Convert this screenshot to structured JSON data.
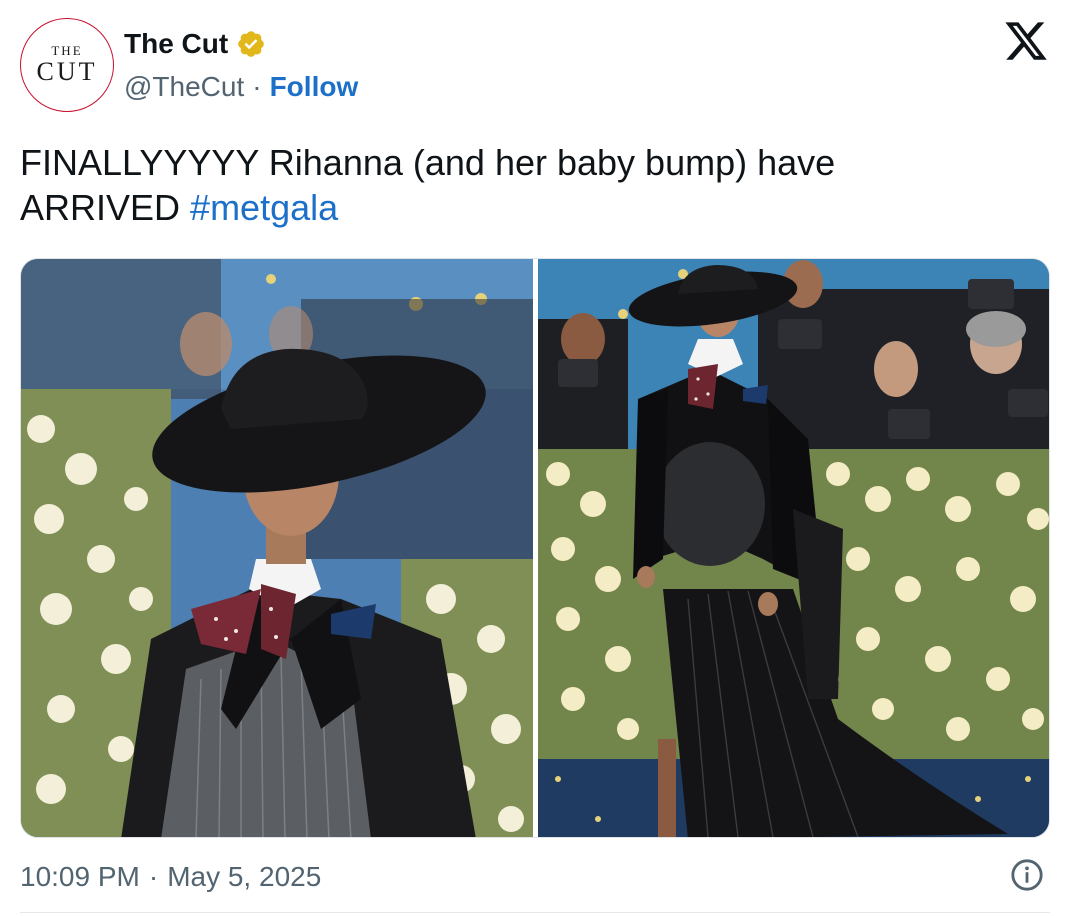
{
  "account": {
    "avatar_top": "THE",
    "avatar_bottom": "CUT",
    "display_name": "The Cut",
    "verified_badge": "gold-verified-badge-icon",
    "handle": "@TheCut",
    "separator": "·",
    "follow_label": "Follow"
  },
  "platform_logo": "x-logo-icon",
  "tweet": {
    "text_line1": "FINALLYYYYY Rihanna (and her baby bump) have",
    "text_line2_prefix": "ARRIVED",
    "hashtag": "#metgala"
  },
  "media": {
    "count": 2,
    "images": [
      {
        "name": "photo-rihanna-closeup"
      },
      {
        "name": "photo-rihanna-full-length"
      }
    ]
  },
  "footer": {
    "time": "10:09 PM",
    "separator": "·",
    "date": "May 5, 2025",
    "info_icon": "info-icon"
  },
  "colors": {
    "link": "#1d70c8",
    "secondary_text": "#536471",
    "primary_text": "#0f1419",
    "verified_gold": "#e2b719"
  }
}
